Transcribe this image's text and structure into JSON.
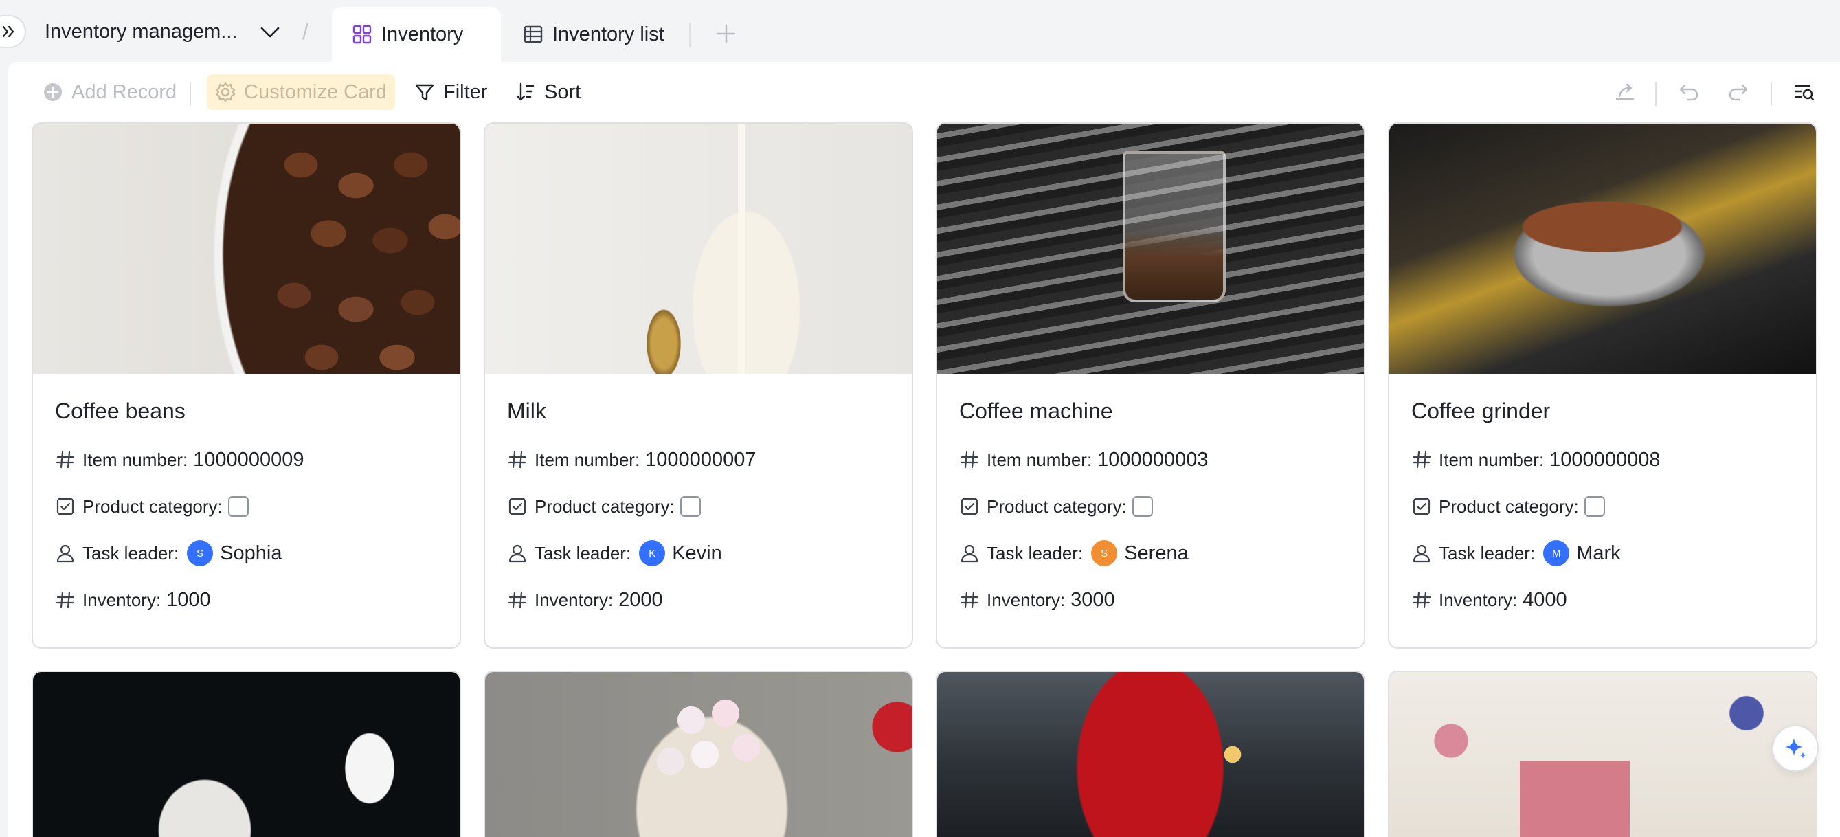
{
  "header": {
    "base_title": "Inventory managem...",
    "tabs": [
      {
        "label": "Inventory"
      },
      {
        "label": "Inventory list"
      }
    ]
  },
  "toolbar": {
    "add_record": "Add Record",
    "customize_card": "Customize Card",
    "filter": "Filter",
    "sort": "Sort"
  },
  "field_labels": {
    "item_number": "Item number:",
    "product_category": "Product category:",
    "task_leader": "Task leader:",
    "inventory": "Inventory:"
  },
  "cards": [
    {
      "title": "Coffee beans",
      "item_number": "1000000009",
      "task_leader": "Sophia",
      "avatar": "S",
      "avatar_color": "#3370ff",
      "inventory": "1000"
    },
    {
      "title": "Milk",
      "item_number": "1000000007",
      "task_leader": "Kevin",
      "avatar": "K",
      "avatar_color": "#3370ff",
      "inventory": "2000"
    },
    {
      "title": "Coffee machine",
      "item_number": "1000000003",
      "task_leader": "Serena",
      "avatar": "S",
      "avatar_color": "#f18e32",
      "inventory": "3000"
    },
    {
      "title": "Coffee grinder",
      "item_number": "1000000008",
      "task_leader": "Mark",
      "avatar": "M",
      "avatar_color": "#3370ff",
      "inventory": "4000"
    }
  ],
  "colors": {
    "accent": "#3370ff",
    "tab_icon": "#7f3bf5",
    "customize_bg": "#fff3d4"
  },
  "icons": {
    "expand": "double-chevron-right-icon",
    "grid_view": "grid-icon",
    "table_view": "table-icon",
    "add": "plus-icon",
    "ai": "sparkle-icon"
  }
}
